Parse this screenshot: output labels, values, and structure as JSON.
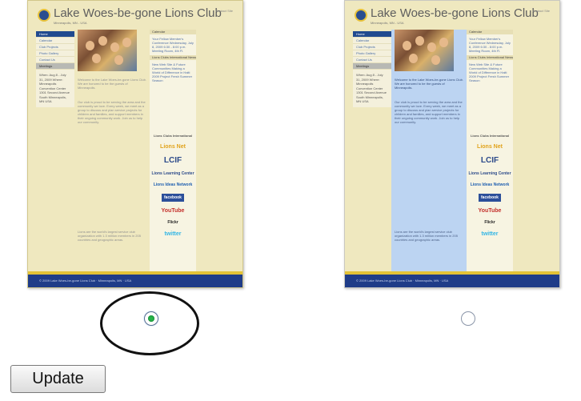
{
  "options": [
    {
      "site_title": "Lake Woes-be-gone Lions Club",
      "site_subtitle": "Minneapolis, MN - USA",
      "header_right": "Contact Site",
      "nav": [
        "Home",
        "Calendar",
        "Club Projects",
        "Photo Gallery",
        "Contact Us",
        "Meetings"
      ],
      "nav_info": "When: Aug 8 - July 31, 2009 Where: Minneapolis Convention Center 1301 Second Avenue South Minneapolis, MN USA",
      "sidebar_headers": [
        "Calendar",
        "Lions Clubs International News"
      ],
      "sidebar_texts": [
        "Your Fellow Member's Conference Wednesday, July 8, 2009 6:30 - 8:00 p.m. Meeting Room, 4th Fl.",
        "New Web Site & Future Communities Making a World of Difference in Haiti 2009 Project Fresh Summer Season"
      ],
      "badges": [
        "Lions Clubs International",
        "Lions Net",
        "LCIF",
        "Lions Learning Center",
        "Lions Ideas Network",
        "facebook",
        "YouTube",
        "Flickr",
        "twitter"
      ],
      "intro_text": "Welcome to the Lake Woes-be-gone Lions Club. We are honored to be the guests of Minneapolis.",
      "body_text": "Our club is proud to be serving the area and the community we love. Every week, we meet as a group to discuss and plan service projects for children and families, and support members in their ongoing community work. Join us to help our community.",
      "footer_note": "Lions are the world's largest service club organization with 1.3 million members in 205 countries and geographic areas.",
      "footer": "© 2009 Lake Woes-be-gone Lions Club · Minneapolis, MN · USA"
    },
    {
      "site_title": "Lake Woes-be-gone Lions Club",
      "site_subtitle": "Minneapolis, MN - USA",
      "header_right": "Contact Site",
      "nav": [
        "Home",
        "Calendar",
        "Club Projects",
        "Photo Gallery",
        "Contact Us",
        "Meetings"
      ],
      "nav_info": "When: Aug 8 - July 31, 2009 Where: Minneapolis Convention Center 1301 Second Avenue South Minneapolis, MN USA",
      "sidebar_headers": [
        "Calendar",
        "Lions Clubs International News"
      ],
      "sidebar_texts": [
        "Your Fellow Member's Conference Wednesday, July 8, 2009 6:30 - 8:00 p.m. Meeting Room, 4th Fl.",
        "New Web Site & Future Communities Making a World of Difference in Haiti 2009 Project Fresh Summer Season"
      ],
      "badges": [
        "Lions Clubs International",
        "Lions Net",
        "LCIF",
        "Lions Learning Center",
        "Lions Ideas Network",
        "facebook",
        "YouTube",
        "Flickr",
        "twitter"
      ],
      "intro_text": "Welcome to the Lake Woes-be-gone Lions Club. We are honored to be the guests of Minneapolis.",
      "body_text": "Our club is proud to be serving the area and the community we love. Every week, we meet as a group to discuss and plan service projects for children and families, and support members in their ongoing community work. Join us to help our community.",
      "footer_note": "Lions are the world's largest service club organization with 1.3 million members in 205 countries and geographic areas.",
      "footer": "© 2009 Lake Woes-be-gone Lions Club · Minneapolis, MN · USA"
    }
  ],
  "selected_option": 1,
  "button_label": "Update",
  "colors": {
    "option1_content_bg": "#efe8bf",
    "option2_content_bg": "#bcd4f2",
    "nav_active": "#214a8f",
    "footer_blue": "#1f3c88",
    "accent_gold": "#e3c236",
    "radio_selected": "#27b54a"
  }
}
